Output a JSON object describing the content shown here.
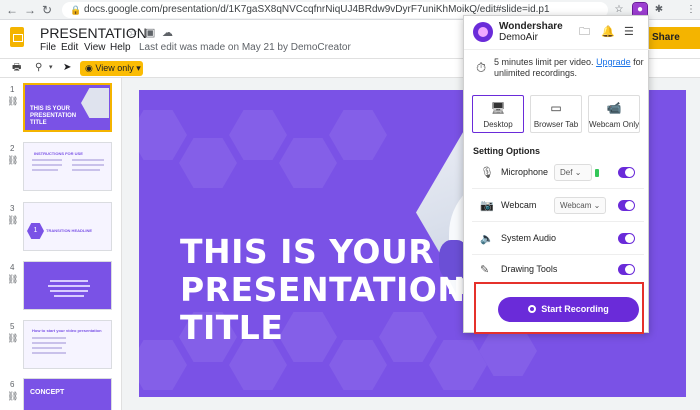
{
  "browser": {
    "url": "docs.google.com/presentation/d/1K7gaSX8qNVCcqfnrNiqUJ4BRdw9vDyrF7uniKhMoikQ/edit#slide=id.p1",
    "back_glyph": "←",
    "forward_glyph": "→",
    "reload_glyph": "↻",
    "lock_glyph": "🔒",
    "star_glyph": "☆",
    "puzzle_glyph": "✱",
    "menu_glyph": "⋮"
  },
  "slides_app": {
    "title": "PRESENTATION",
    "menu": [
      "File",
      "Edit",
      "View",
      "Help"
    ],
    "last_edit": "Last edit was made on May 21 by DemoCreator",
    "share_label": "Share",
    "view_only_label": "◉ View only ▾",
    "icons": {
      "star": "☆",
      "drive": "▣",
      "cloud": "☁",
      "print": "🖶",
      "zoom": "⚲",
      "zoom_caret": "▾",
      "pointer": "➤"
    }
  },
  "filmstrip": {
    "link_glyph": "⛓",
    "slides": [
      {
        "number": "1",
        "text": "THIS IS YOUR PRESENTATION TITLE"
      },
      {
        "number": "2",
        "text": "INSTRUCTIONS FOR USE"
      },
      {
        "number": "3",
        "text": "TRANSITION HEADLINE"
      },
      {
        "number": "4",
        "text": ""
      },
      {
        "number": "5",
        "text": "How to start your video presentation"
      },
      {
        "number": "6",
        "text": "CONCEPT"
      }
    ]
  },
  "main_slide": {
    "title": "THIS IS YOUR PRESENTATION TITLE"
  },
  "demoair": {
    "brand_line1": "Wondershare",
    "brand_line2": "DemoAir",
    "header_icons": {
      "folder": "🗀",
      "bell": "🔔",
      "menu": "☰"
    },
    "limit_text": "5 minutes limit per video.",
    "upgrade_label": "Upgrade",
    "limit_suffix": " for unlimited recordings.",
    "timer_glyph": "⏱",
    "modes": [
      {
        "label": "Desktop",
        "icon": "🖥",
        "active": true
      },
      {
        "label": "Browser Tab",
        "icon": "▭",
        "active": false
      },
      {
        "label": "Webcam Only",
        "icon": "📹",
        "active": false
      }
    ],
    "settings_heading": "Setting Options",
    "settings": {
      "microphone": {
        "label": "Microphone",
        "icon": "🎙",
        "select": "Def",
        "caret": "⌄"
      },
      "webcam": {
        "label": "Webcam",
        "icon": "📷",
        "select": "Webcam",
        "caret": "⌄"
      },
      "system_audio": {
        "label": "System Audio",
        "icon": "🔈"
      },
      "drawing_tools": {
        "label": "Drawing Tools",
        "icon": "✎"
      }
    },
    "start_label": "Start Recording"
  },
  "colors": {
    "slides_yellow": "#f4b400",
    "slide_purple": "#7a52e6",
    "demoair_purple": "#6a2bd9",
    "highlight_red": "#e5312b"
  }
}
